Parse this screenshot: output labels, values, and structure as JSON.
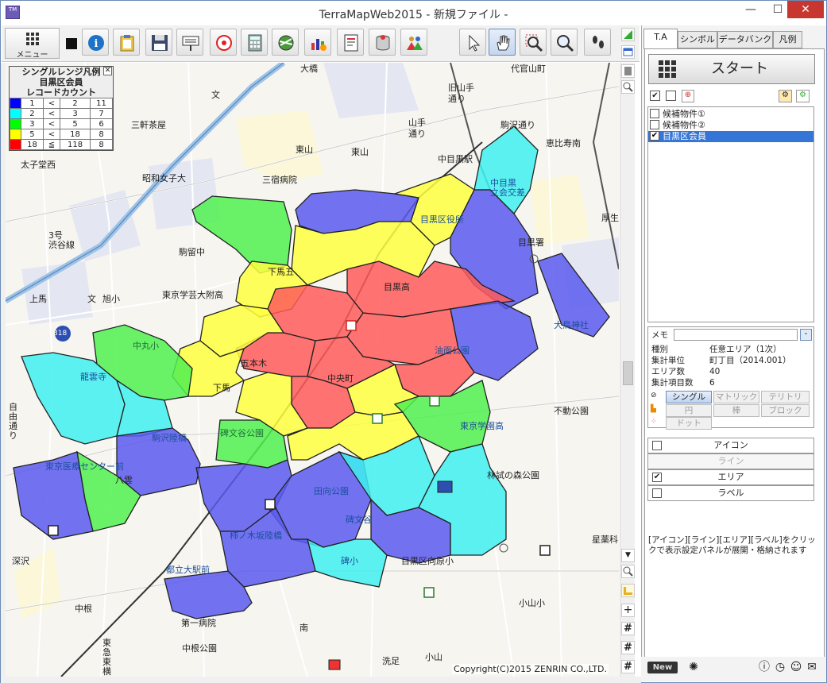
{
  "window": {
    "title": "TerraMapWeb2015  - 新規ファイル -",
    "app_icon_text": "TM",
    "minimize": "—",
    "maximize": "☐",
    "close": "✕"
  },
  "toolbar": {
    "menu_label": "メニュー"
  },
  "legend": {
    "title": "シングルレンジ凡例",
    "line2": "目黒区会員",
    "line3": "レコードカウント",
    "close": "✕",
    "rows": [
      {
        "color": "#0000ff",
        "from": "1",
        "op": "<",
        "to": "2",
        "count": "11"
      },
      {
        "color": "#00ffff",
        "from": "2",
        "op": "<",
        "to": "3",
        "count": "7"
      },
      {
        "color": "#00ff00",
        "from": "3",
        "op": "<",
        "to": "5",
        "count": "6"
      },
      {
        "color": "#ffff00",
        "from": "5",
        "op": "<",
        "to": "18",
        "count": "8"
      },
      {
        "color": "#ff0000",
        "from": "18",
        "op": "≦",
        "to": "118",
        "count": "8"
      }
    ]
  },
  "map": {
    "labels": {
      "ohashi": "大橋",
      "kyuyamate": "旧山手",
      "kyuyamate2": "通り",
      "daikanyama": "代官山町",
      "bun1": "文",
      "sangenjaya": "三軒茶屋",
      "yamate": "山手",
      "yamate2": "通り",
      "komazawa": "駒沢通り",
      "higashiyama1": "東山",
      "higashiyama2": "東山",
      "higashiebisu": "恵比寿南",
      "nakameguro": "中目黒駅",
      "taishido": "太子堂西",
      "showajoshi": "昭和女子大",
      "sanshuku": "三宿病院",
      "nakameguro2": "中目黒",
      "tachiaikou": "立会交差",
      "meguroku": "目黒区役所",
      "kose": "厚生",
      "route3": "3号",
      "shibuya": "渋谷線",
      "komaba": "駒留中",
      "megurosho": "目黒署",
      "shimouma5": "下馬五",
      "megurotaka": "目黒高",
      "tokyogakugei": "東京学芸大附高",
      "bun2": "文",
      "kamiuma": "上馬",
      "asahi": "旭小",
      "ootori": "大鳥神社",
      "route318": "318",
      "nakamaru": "中丸小",
      "aburamen": "油面公園",
      "gotenzan": "五本木",
      "ryuunji": "龍雲寺",
      "nakacho": "中央町",
      "shimouma": "下馬",
      "fudokoen": "不動公園",
      "jiyudori": "自由通り",
      "himonya": "碑文谷公園",
      "tokyogakuen": "東京学園高",
      "komazawarikkyo": "駒沢陸橋",
      "tokyoiryo": "東京医療センター前",
      "hakkei": "八雲",
      "dendenkoen": "田向公園",
      "rinshi": "林試の森公園",
      "himonya2": "碑文谷",
      "himonyasho": "碑小",
      "kakinokizaka": "柿ノ木坂陸橋",
      "fukasawa": "深沢",
      "megurohara": "目黒区向原小",
      "toritsudai": "都立大駅前",
      "hoshiyakushi": "星薬科",
      "nakane": "中根",
      "koyamasho": "小山小",
      "daiichibyoin": "第一病院",
      "minami": "南",
      "higashikyu": "東急東横",
      "nakanekoen": "中根公園",
      "senzoku": "洗足",
      "koyama": "小山"
    },
    "copyright": "Copyright(C)2015 ZENRIN CO.,LTD."
  },
  "side": {
    "tabs": [
      "T.A",
      "シンボル",
      "データバンク",
      "凡例"
    ],
    "start": "スタート",
    "list": [
      {
        "label": "候補物件①",
        "checked": false
      },
      {
        "label": "候補物件②",
        "checked": false
      },
      {
        "label": "目黒区会員",
        "checked": true
      }
    ],
    "info": {
      "memo": "メモ",
      "memo_btn": "-",
      "rows": [
        {
          "k": "種別",
          "v": "任意エリア（1次）"
        },
        {
          "k": "集計単位",
          "v": "町丁目（2014.001）"
        },
        {
          "k": "エリア数",
          "v": "40"
        },
        {
          "k": "集計項目数",
          "v": "6"
        }
      ],
      "modes1": [
        "シングル",
        "マトリックス",
        "テリトリ"
      ],
      "modes2": [
        "円",
        "棒",
        "ブロック"
      ],
      "modes3": [
        "ドット"
      ]
    },
    "layers": [
      {
        "label": "アイコン",
        "checked": false,
        "enabled": true
      },
      {
        "label": "ライン",
        "checked": false,
        "enabled": false
      },
      {
        "label": "エリア",
        "checked": true,
        "enabled": true
      },
      {
        "label": "ラベル",
        "checked": false,
        "enabled": true
      }
    ],
    "hint": "[アイコン][ライン][エリア][ラベル]をクリックで表示設定パネルが展開・格納されます",
    "new_badge": "New"
  }
}
